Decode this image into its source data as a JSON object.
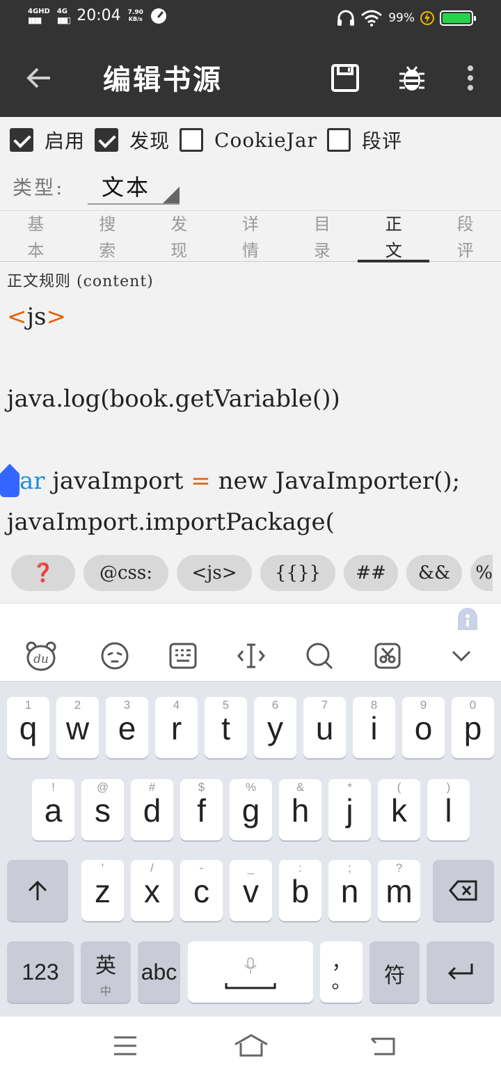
{
  "status": {
    "network_1": "4GHD",
    "network_2": "4G",
    "time": "20:04",
    "speed_value": "7.90",
    "speed_unit": "KB/s",
    "battery": "99%",
    "battery_level": 0.99
  },
  "appbar": {
    "title": "编辑书源",
    "icons": [
      "back-arrow-icon",
      "save-icon",
      "bug-icon",
      "more-vert-icon"
    ]
  },
  "options": [
    {
      "label": "启用",
      "checked": true
    },
    {
      "label": "发现",
      "checked": true
    },
    {
      "label": "CookieJar",
      "checked": false
    },
    {
      "label": "段评",
      "checked": false
    }
  ],
  "type_selector": {
    "label": "类型:",
    "value": "文本"
  },
  "tabs": [
    {
      "label": "基本",
      "active": false
    },
    {
      "label": "搜索",
      "active": false
    },
    {
      "label": "发现",
      "active": false
    },
    {
      "label": "详情",
      "active": false
    },
    {
      "label": "目录",
      "active": false
    },
    {
      "label": "正文",
      "active": true
    },
    {
      "label": "段评",
      "active": false
    }
  ],
  "editor": {
    "field_label": "正文规则 (content)",
    "lines": {
      "l1_open": "<",
      "l1_text": "js",
      "l1_close": ">",
      "l3": "java.log(book.getVariable())",
      "l5_kw": "ar",
      "l5_a": " javaImport ",
      "l5_op": "=",
      "l5_b": " new JavaImporter();",
      "l6": "javaImport.importPackage("
    }
  },
  "snippets": [
    "❓",
    "@css:",
    "<js>",
    "{{}}",
    "##",
    "&&",
    "%"
  ],
  "keyboard": {
    "toolbar_icons": [
      "du-bear-icon",
      "emoji-icon",
      "keyboard-icon",
      "cursor-icon",
      "search-icon",
      "clipboard-icon",
      "collapse-icon"
    ],
    "row1": [
      {
        "k": "q",
        "s": "1"
      },
      {
        "k": "w",
        "s": "2"
      },
      {
        "k": "e",
        "s": "3"
      },
      {
        "k": "r",
        "s": "4"
      },
      {
        "k": "t",
        "s": "5"
      },
      {
        "k": "y",
        "s": "6"
      },
      {
        "k": "u",
        "s": "7"
      },
      {
        "k": "i",
        "s": "8"
      },
      {
        "k": "o",
        "s": "9"
      },
      {
        "k": "p",
        "s": "0"
      }
    ],
    "row2": [
      {
        "k": "a",
        "s": "!"
      },
      {
        "k": "s",
        "s": "@"
      },
      {
        "k": "d",
        "s": "#"
      },
      {
        "k": "f",
        "s": "$"
      },
      {
        "k": "g",
        "s": "%"
      },
      {
        "k": "h",
        "s": "&"
      },
      {
        "k": "j",
        "s": "*"
      },
      {
        "k": "k",
        "s": "("
      },
      {
        "k": "l",
        "s": ")"
      }
    ],
    "row3": [
      {
        "k": "z",
        "s": "'"
      },
      {
        "k": "x",
        "s": "/"
      },
      {
        "k": "c",
        "s": "-"
      },
      {
        "k": "v",
        "s": "_"
      },
      {
        "k": "b",
        "s": ":"
      },
      {
        "k": "n",
        "s": ";"
      },
      {
        "k": "m",
        "s": "?"
      }
    ],
    "num_key": "123",
    "lang_key": "英",
    "lang_sub": "中",
    "abc_key": "abc",
    "punct_key": "，",
    "punct_sub": "。",
    "symbol_key": "符"
  },
  "navbar": {
    "icons": [
      "menu-icon",
      "home-icon",
      "back-icon"
    ]
  }
}
